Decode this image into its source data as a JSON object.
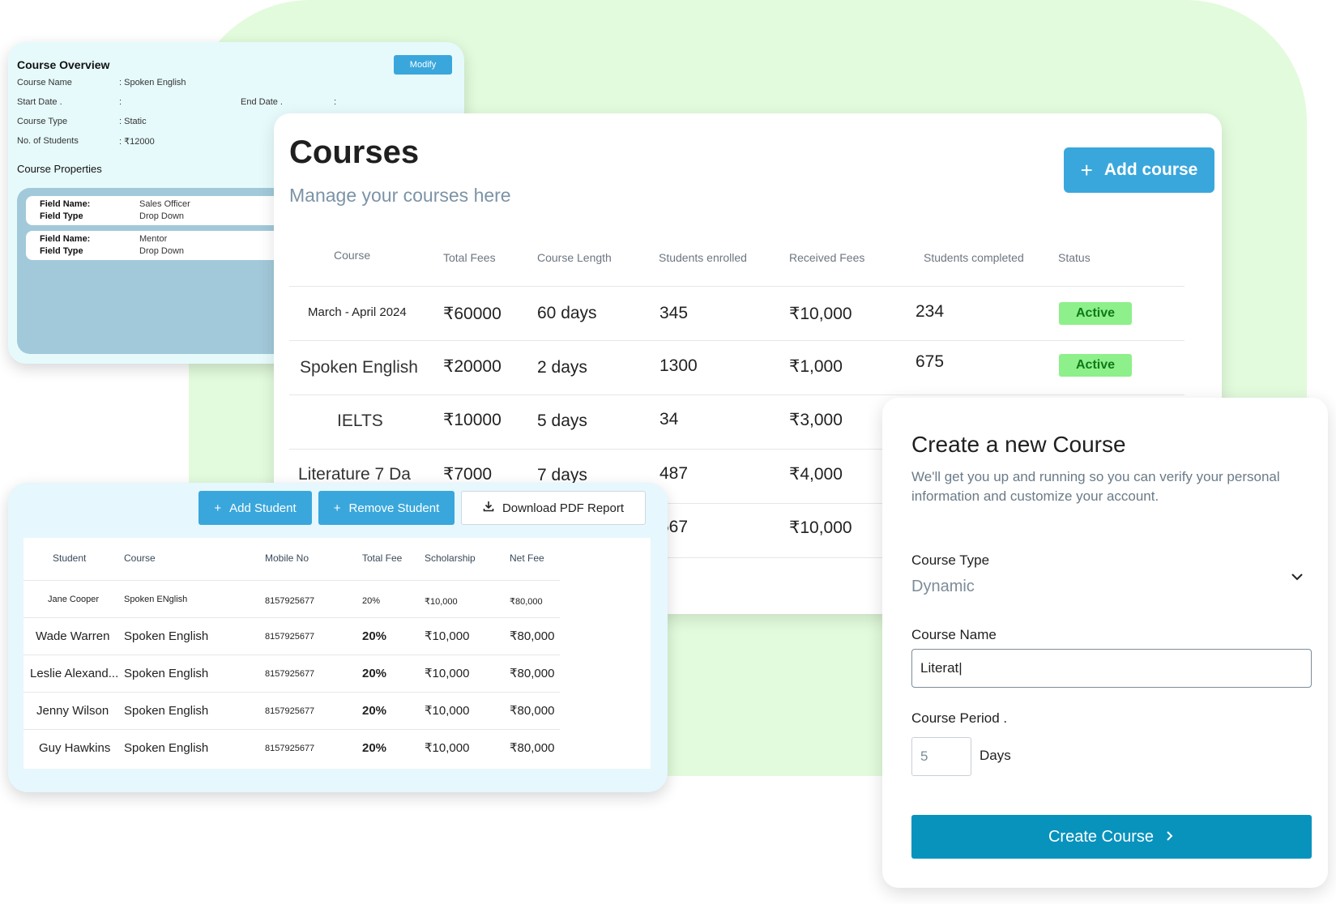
{
  "overview": {
    "title": "Course Overview",
    "modify_label": "Modify",
    "rows": [
      {
        "label": "Course Name",
        "value": ": Spoken English"
      },
      {
        "label": "Start Date .",
        "value": ":"
      },
      {
        "label": "Course Type",
        "value": ": Static"
      },
      {
        "label": "No. of Students",
        "value": ": ₹12000"
      }
    ],
    "end_date_label": "End Date .",
    "end_date_value": ":",
    "properties_title": "Course Properties",
    "properties": [
      {
        "name_key": "Field Name:",
        "name_val": "Sales Officer",
        "type_key": "Field Type",
        "type_val": "Drop Down"
      },
      {
        "name_key": "Field Name:",
        "name_val": "Mentor",
        "type_key": "Field Type",
        "type_val": "Drop Down"
      }
    ]
  },
  "courses": {
    "title": "Courses",
    "subtitle": "Manage your courses here",
    "add_label": "Add course",
    "headers": [
      "Course",
      "Total Fees",
      "Course Length",
      "Students enrolled",
      "Received Fees",
      "Students completed",
      "Status"
    ],
    "rows": [
      {
        "course": "March - April 2024",
        "fees": "₹60000",
        "length": "60 days",
        "enrolled": "345",
        "received": "₹10,000",
        "completed": "234",
        "status": "Active"
      },
      {
        "course": "Spoken English",
        "fees": "₹20000",
        "length": "2 days",
        "enrolled": "1300",
        "received": "₹1,000",
        "completed": "675",
        "status": "Active"
      },
      {
        "course": "IELTS",
        "fees": "₹10000",
        "length": "5 days",
        "enrolled": "34",
        "received": "₹3,000",
        "completed": "",
        "status": ""
      },
      {
        "course": "Literature 7 Da",
        "fees": "₹7000",
        "length": "7 days",
        "enrolled": "487",
        "received": "₹4,000",
        "completed": "",
        "status": ""
      },
      {
        "course": "",
        "fees": "",
        "length": "",
        "enrolled": "567",
        "received": "₹10,000",
        "completed": "",
        "status": ""
      }
    ],
    "status_color": "#8ef08a"
  },
  "students": {
    "add_label": "Add Student",
    "remove_label": "Remove Student",
    "download_label": "Download PDF Report",
    "headers": [
      "Student",
      "Course",
      "Mobile No",
      "Total Fee",
      "Scholarship",
      "Net Fee"
    ],
    "rows": [
      {
        "student": "Jane Cooper",
        "course": "Spoken ENglish",
        "mobile": "8157925677",
        "total": "20%",
        "scholarship": "₹10,000",
        "net": "₹80,000"
      },
      {
        "student": "Wade Warren",
        "course": "Spoken English",
        "mobile": "8157925677",
        "total": "20%",
        "scholarship": "₹10,000",
        "net": "₹80,000"
      },
      {
        "student": "Leslie Alexand...",
        "course": "Spoken English",
        "mobile": "8157925677",
        "total": "20%",
        "scholarship": "₹10,000",
        "net": "₹80,000"
      },
      {
        "student": "Jenny Wilson",
        "course": "Spoken English",
        "mobile": "8157925677",
        "total": "20%",
        "scholarship": "₹10,000",
        "net": "₹80,000"
      },
      {
        "student": "Guy Hawkins",
        "course": "Spoken English",
        "mobile": "8157925677",
        "total": "20%",
        "scholarship": "₹10,000",
        "net": "₹80,000"
      }
    ]
  },
  "create": {
    "title": "Create a new Course",
    "description": "We'll get you up and running so you can verify your personal information and customize your account.",
    "type_label": "Course Type",
    "type_value": "Dynamic",
    "name_label": "Course Name",
    "name_value": "Literat|",
    "period_label": "Course Period .",
    "period_placeholder": "5",
    "days_label": "Days",
    "submit_label": "Create Course"
  },
  "colors": {
    "accent": "#3aa7dc",
    "primary_button": "#0893bd",
    "background_blob": "#e2fbdc"
  }
}
